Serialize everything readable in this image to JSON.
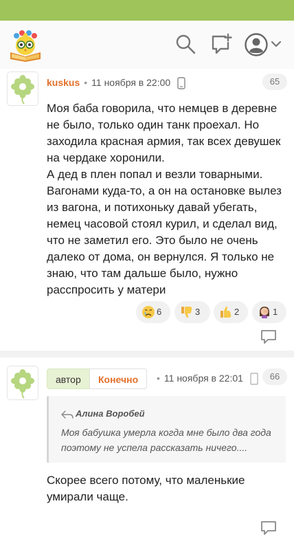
{
  "header": {
    "logo_icon": "owl-on-book-logo",
    "search_icon": "search-icon",
    "new_post_icon": "new-post-icon",
    "profile_icon": "user-avatar-icon",
    "menu_icon": "chevron-down-icon",
    "status_bar_color": "#9ec45a"
  },
  "comments": [
    {
      "avatar_icon": "flower-avatar",
      "username": "kuskus",
      "date": "11 ноября в 22:00",
      "device_icon": "mobile-device-icon",
      "number": "65",
      "text": "Моя баба говорила, что немцев в деревне не было, только один танк проехал. Но заходила красная армия, так всех девушек на чердаке хоронили.\nА дед в плен попал и везли товарными. Вагонами куда-то, а он на остановке вылез из вагона, и потихоньку давай убегать, немец часовой стоял курил, и сделал вид, что не заметил его. Это было не очень далеко от дома, он вернулся. Я только не знаю, что там дальше было, нужно расспросить у матери",
      "reactions": [
        {
          "emoji": "crying-face",
          "count": "6"
        },
        {
          "emoji": "thumbs-down",
          "count": "3"
        },
        {
          "emoji": "thumbs-up",
          "count": "2"
        },
        {
          "emoji": "facepalm",
          "count": "1"
        }
      ],
      "reply_icon": "reply-icon"
    },
    {
      "avatar_icon": "flower-avatar",
      "author_tag": "автор",
      "username": "Конечно",
      "date": "11 ноября в 22:01",
      "number": "66",
      "quote": {
        "author": "Алина Воробей",
        "text": "Моя бабушка умерла когда мне было два года поэтому не успела рассказать ничего...."
      },
      "text": "Скорее всего потому, что маленькие умирали чаще.",
      "reply_icon": "reply-icon"
    }
  ]
}
